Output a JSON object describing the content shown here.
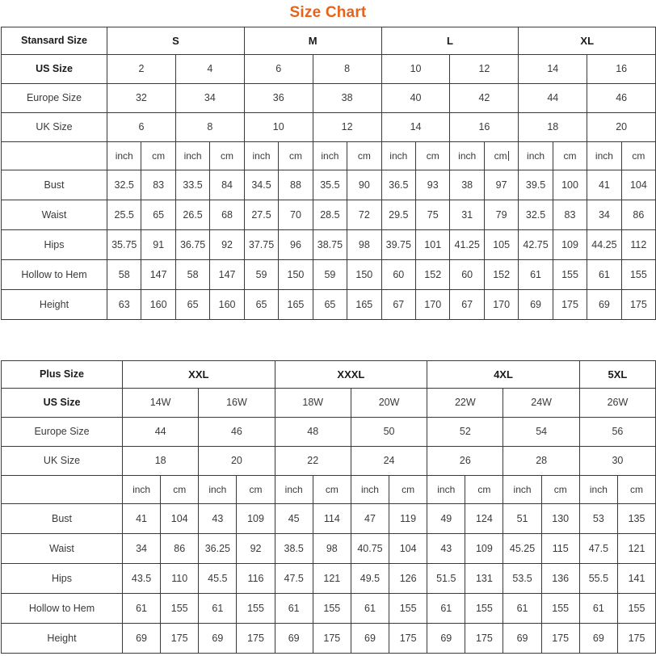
{
  "title": "Size Chart",
  "accent_color": "#E8621A",
  "tables": [
    {
      "id": "standard-size-table",
      "corner_label": "Stansard Size",
      "size_headers": [
        {
          "label": "S",
          "span": 4
        },
        {
          "label": "M",
          "span": 4
        },
        {
          "label": "L",
          "span": 4
        },
        {
          "label": "XL",
          "span": 4
        }
      ],
      "rows": [
        {
          "label": "US Size",
          "bold": true,
          "span": 2,
          "values": [
            "2",
            "4",
            "6",
            "8",
            "10",
            "12",
            "14",
            "16"
          ]
        },
        {
          "label": "Europe Size",
          "bold": false,
          "span": 2,
          "values": [
            "32",
            "34",
            "36",
            "38",
            "40",
            "42",
            "44",
            "46"
          ]
        },
        {
          "label": "UK Size",
          "bold": false,
          "span": 2,
          "values": [
            "6",
            "8",
            "10",
            "12",
            "14",
            "16",
            "18",
            "20"
          ]
        }
      ],
      "unit_row": {
        "label": "",
        "units": [
          "inch",
          "cm",
          "inch",
          "cm",
          "inch",
          "cm",
          "inch",
          "cm",
          "inch",
          "cm",
          "inch",
          "cm",
          "inch",
          "cm",
          "inch",
          "cm"
        ]
      },
      "measurements": [
        {
          "label": "Bust",
          "values": [
            "32.5",
            "83",
            "33.5",
            "84",
            "34.5",
            "88",
            "35.5",
            "90",
            "36.5",
            "93",
            "38",
            "97",
            "39.5",
            "100",
            "41",
            "104"
          ]
        },
        {
          "label": "Waist",
          "values": [
            "25.5",
            "65",
            "26.5",
            "68",
            "27.5",
            "70",
            "28.5",
            "72",
            "29.5",
            "75",
            "31",
            "79",
            "32.5",
            "83",
            "34",
            "86"
          ]
        },
        {
          "label": "Hips",
          "values": [
            "35.75",
            "91",
            "36.75",
            "92",
            "37.75",
            "96",
            "38.75",
            "98",
            "39.75",
            "101",
            "41.25",
            "105",
            "42.75",
            "109",
            "44.25",
            "112"
          ]
        },
        {
          "label": "Hollow to Hem",
          "values": [
            "58",
            "147",
            "58",
            "147",
            "59",
            "150",
            "59",
            "150",
            "60",
            "152",
            "60",
            "152",
            "61",
            "155",
            "61",
            "155"
          ]
        },
        {
          "label": "Height",
          "values": [
            "63",
            "160",
            "65",
            "160",
            "65",
            "165",
            "65",
            "165",
            "67",
            "170",
            "67",
            "170",
            "69",
            "175",
            "69",
            "175"
          ]
        }
      ]
    },
    {
      "id": "plus-size-table",
      "corner_label": "Plus Size",
      "size_headers": [
        {
          "label": "XXL",
          "span": 4
        },
        {
          "label": "XXXL",
          "span": 4
        },
        {
          "label": "4XL",
          "span": 4
        },
        {
          "label": "5XL",
          "span": 2
        }
      ],
      "rows": [
        {
          "label": "US Size",
          "bold": true,
          "span": 2,
          "values": [
            "14W",
            "16W",
            "18W",
            "20W",
            "22W",
            "24W",
            "26W"
          ]
        },
        {
          "label": "Europe Size",
          "bold": false,
          "span": 2,
          "values": [
            "44",
            "46",
            "48",
            "50",
            "52",
            "54",
            "56"
          ]
        },
        {
          "label": "UK Size",
          "bold": false,
          "span": 2,
          "values": [
            "18",
            "20",
            "22",
            "24",
            "26",
            "28",
            "30"
          ]
        }
      ],
      "unit_row": {
        "label": "",
        "units": [
          "inch",
          "cm",
          "inch",
          "cm",
          "inch",
          "cm",
          "inch",
          "cm",
          "inch",
          "cm",
          "inch",
          "cm",
          "inch",
          "cm"
        ]
      },
      "measurements": [
        {
          "label": "Bust",
          "values": [
            "41",
            "104",
            "43",
            "109",
            "45",
            "114",
            "47",
            "119",
            "49",
            "124",
            "51",
            "130",
            "53",
            "135"
          ]
        },
        {
          "label": "Waist",
          "values": [
            "34",
            "86",
            "36.25",
            "92",
            "38.5",
            "98",
            "40.75",
            "104",
            "43",
            "109",
            "45.25",
            "115",
            "47.5",
            "121"
          ]
        },
        {
          "label": "Hips",
          "values": [
            "43.5",
            "110",
            "45.5",
            "116",
            "47.5",
            "121",
            "49.5",
            "126",
            "51.5",
            "131",
            "53.5",
            "136",
            "55.5",
            "141"
          ]
        },
        {
          "label": "Hollow to Hem",
          "values": [
            "61",
            "155",
            "61",
            "155",
            "61",
            "155",
            "61",
            "155",
            "61",
            "155",
            "61",
            "155",
            "61",
            "155"
          ]
        },
        {
          "label": "Height",
          "values": [
            "69",
            "175",
            "69",
            "175",
            "69",
            "175",
            "69",
            "175",
            "69",
            "175",
            "69",
            "175",
            "69",
            "175"
          ]
        }
      ]
    }
  ]
}
